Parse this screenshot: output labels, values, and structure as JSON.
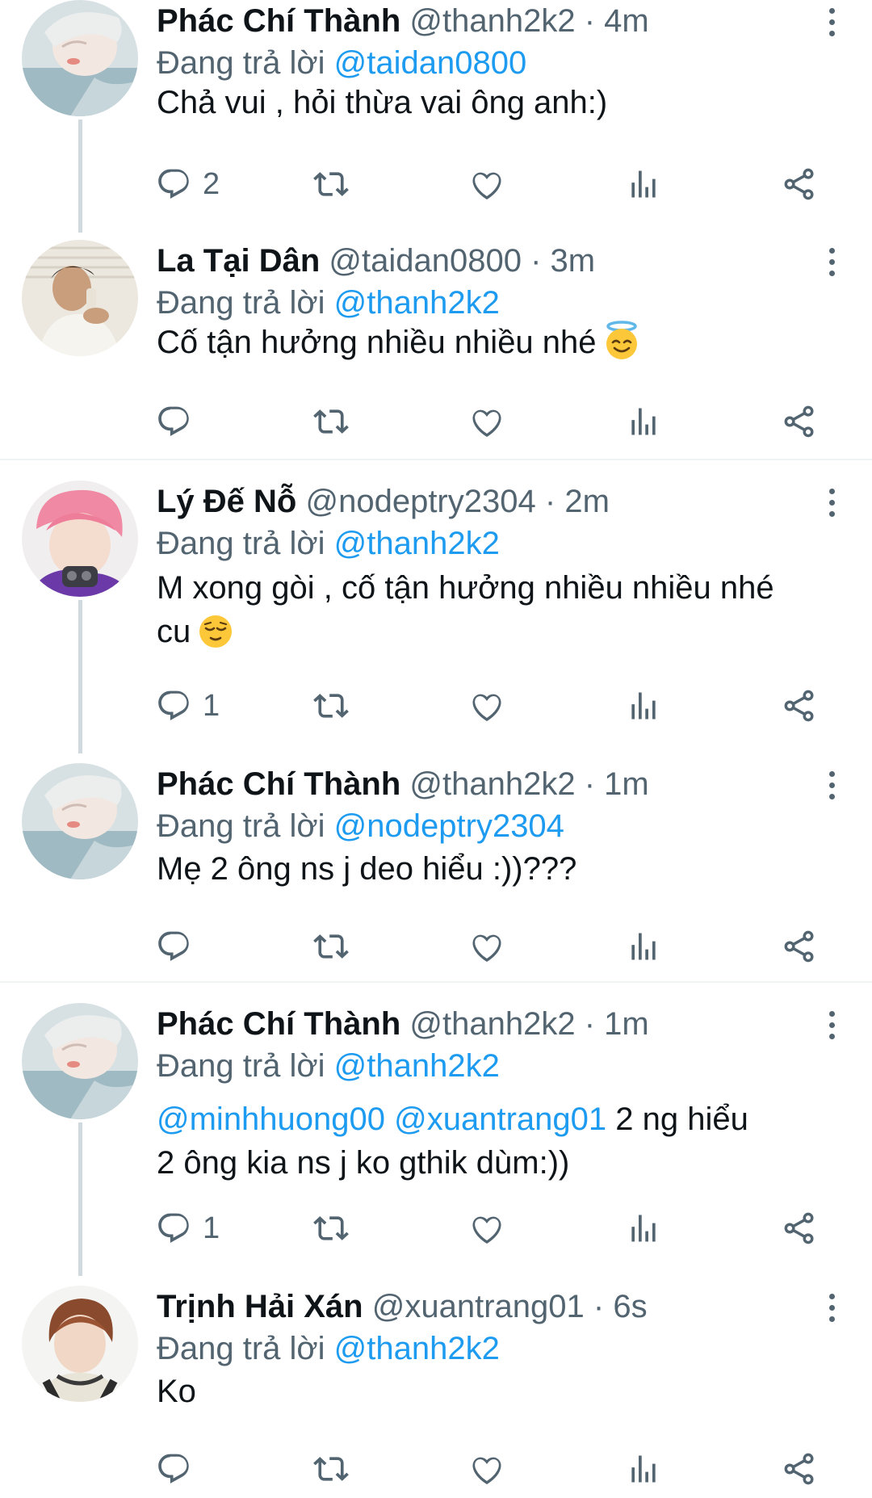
{
  "colors": {
    "accent": "#1d9bf0",
    "secondary_text": "#536471",
    "primary_text": "#0f1419",
    "thread_line": "#cfd9de"
  },
  "tweets": [
    {
      "name": "Phác Chí Thành",
      "handle": "@thanh2k2",
      "dot": "·",
      "time": "4m",
      "replying_prefix": "Đang trả lời",
      "replying_to": "@taidan0800",
      "text": "Chả vui , hỏi thừa vai ông anh:)",
      "reply_count": "2",
      "avatar": "avatar-light-hair",
      "emoji": ""
    },
    {
      "name": "La Tại Dân",
      "handle": "@taidan0800",
      "dot": "·",
      "time": "3m",
      "replying_prefix": "Đang trả lời",
      "replying_to": "@thanh2k2",
      "text": "Cố tận hưởng nhiều nhiều nhé",
      "reply_count": "",
      "avatar": "avatar-dark-hair",
      "emoji": "smiling-face-with-halo"
    },
    {
      "name": "Lý Đế Nỗ",
      "handle": "@nodeptry2304",
      "dot": "·",
      "time": "2m",
      "replying_prefix": "Đang trả lời",
      "replying_to": "@thanh2k2",
      "text_line1": "M xong gòi , cố tận hưởng nhiều nhiều nhé",
      "text_line2": "cu",
      "reply_count": "1",
      "avatar": "avatar-pink-hair",
      "emoji": "relieved-face"
    },
    {
      "name": "Phác Chí Thành",
      "handle": "@thanh2k2",
      "dot": "·",
      "time": "1m",
      "replying_prefix": "Đang trả lời",
      "replying_to": "@nodeptry2304",
      "text": "Mẹ 2 ông ns j deo hiểu :))???",
      "reply_count": "",
      "avatar": "avatar-light-hair",
      "emoji": ""
    },
    {
      "name": "Phác Chí Thành",
      "handle": "@thanh2k2",
      "dot": "·",
      "time": "1m",
      "replying_prefix": "Đang trả lời",
      "replying_to": "@thanh2k2",
      "mention1": "@minhhuong00",
      "mention2": "@xuantrang01",
      "text_rest": "2 ng hiểu",
      "text_line2": "2 ông kia ns j ko gthik dùm:))",
      "reply_count": "1",
      "avatar": "avatar-light-hair",
      "emoji": ""
    },
    {
      "name": "Trịnh Hải Xán",
      "handle": "@xuantrang01",
      "dot": "·",
      "time": "6s",
      "replying_prefix": "Đang trả lời",
      "replying_to": "@thanh2k2",
      "text": "Ko",
      "reply_count": "",
      "avatar": "avatar-brown-hair",
      "emoji": ""
    }
  ],
  "actions": [
    "reply",
    "retweet",
    "like",
    "views",
    "share"
  ]
}
